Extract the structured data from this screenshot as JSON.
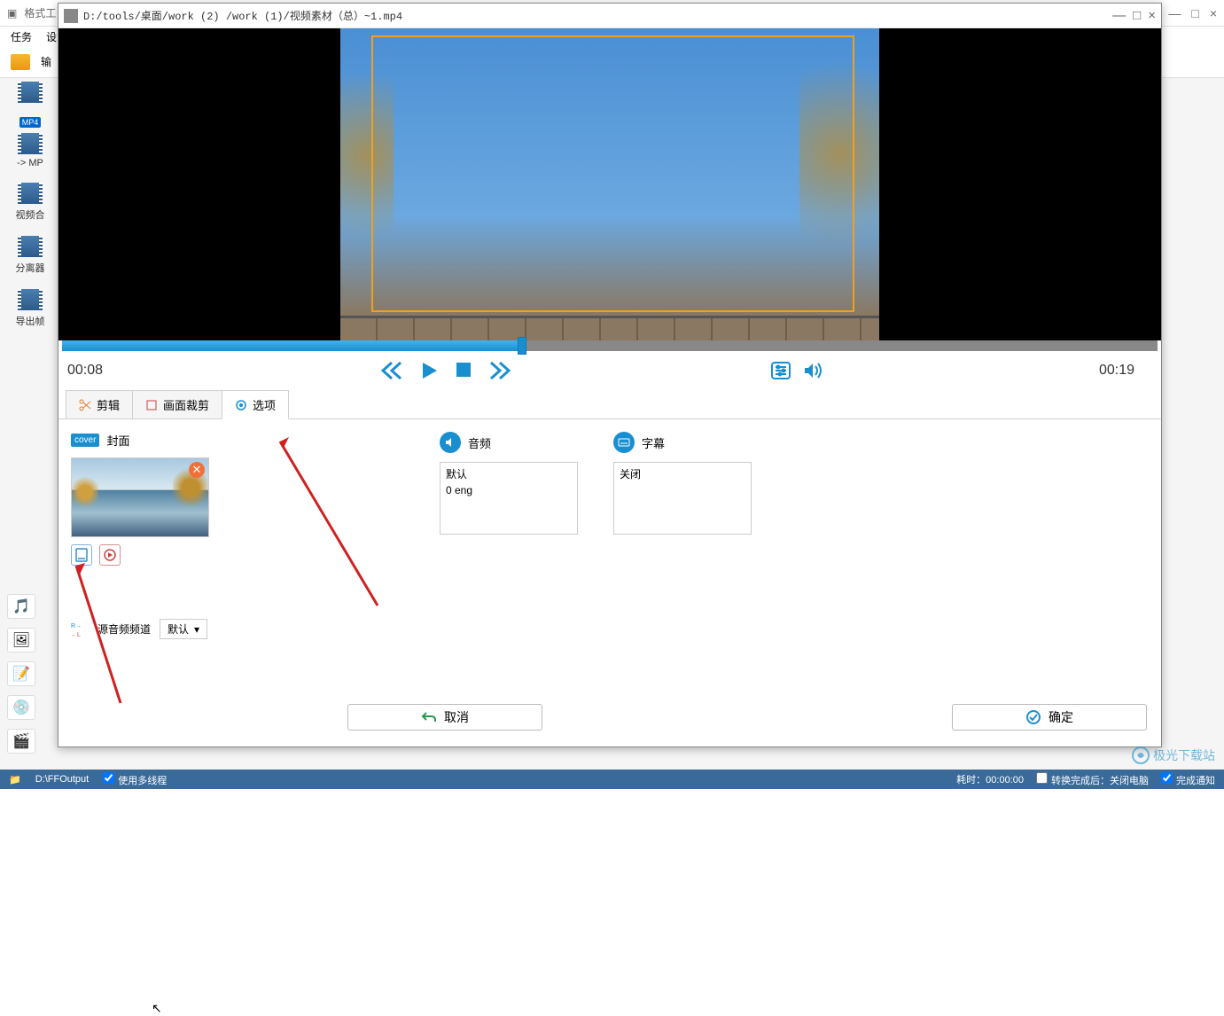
{
  "bgApp": {
    "title": "格式工",
    "menu": {
      "task": "任务",
      "settings": "设"
    },
    "toolbar": {
      "output": "输"
    }
  },
  "sidebar": {
    "items": [
      {
        "label": ""
      },
      {
        "badge": "MP4",
        "label": "-> MP"
      },
      {
        "label": "视频合"
      },
      {
        "label": "分离器"
      },
      {
        "label": "导出帧"
      }
    ]
  },
  "dialog": {
    "path": "D:/tools/桌面/work (2) /work (1)/视频素材（总）~1.mp4",
    "timeLeft": "00:08",
    "timeRight": "00:19",
    "tabs": {
      "edit": "剪辑",
      "crop": "画面裁剪",
      "options": "选项"
    },
    "cover": {
      "label": "封面",
      "badge": "cover"
    },
    "audio": {
      "label": "音频",
      "listLine1": "默认",
      "listLine2": "0 eng"
    },
    "subtitle": {
      "label": "字幕",
      "listLine1": "关闭"
    },
    "sourceAudio": {
      "label": "源音频频道",
      "value": "默认"
    },
    "buttons": {
      "cancel": "取消",
      "ok": "确定"
    }
  },
  "statusbar": {
    "path": "D:\\FFOutput",
    "multithread": "使用多线程",
    "elapsed": "耗时：00:00:00",
    "afterConvert": "转换完成后：关闭电脑",
    "notify": "完成通知"
  },
  "watermark": "极光下载站"
}
